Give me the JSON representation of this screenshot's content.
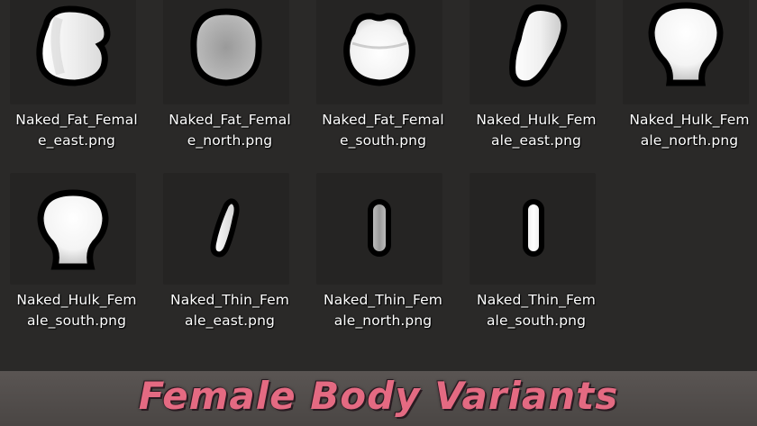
{
  "files": [
    {
      "line1": "Naked_Fat_Femal",
      "line2": "e_east.png",
      "shape": "fat-east-blob-icon"
    },
    {
      "line1": "Naked_Fat_Femal",
      "line2": "e_north.png",
      "shape": "fat-north-blob-icon"
    },
    {
      "line1": "Naked_Fat_Femal",
      "line2": "e_south.png",
      "shape": "fat-south-blob-icon"
    },
    {
      "line1": "Naked_Hulk_Fem",
      "line2": "ale_east.png",
      "shape": "hulk-east-blob-icon"
    },
    {
      "line1": "Naked_Hulk_Fem",
      "line2": "ale_north.png",
      "shape": "hulk-north-blob-icon"
    },
    {
      "line1": "Naked_Hulk_Fem",
      "line2": "ale_south.png",
      "shape": "hulk-south-blob-icon"
    },
    {
      "line1": "Naked_Thin_Fem",
      "line2": "ale_east.png",
      "shape": "thin-east-blob-icon"
    },
    {
      "line1": "Naked_Thin_Fem",
      "line2": "ale_north.png",
      "shape": "thin-north-blob-icon"
    },
    {
      "line1": "Naked_Thin_Fem",
      "line2": "ale_south.png",
      "shape": "thin-south-blob-icon"
    }
  ],
  "banner": {
    "title": "Female Body Variants"
  },
  "colors": {
    "background": "#2a2928",
    "thumb_bg": "#252423",
    "footer": "#524d4b",
    "banner_text": "#e46a82"
  }
}
